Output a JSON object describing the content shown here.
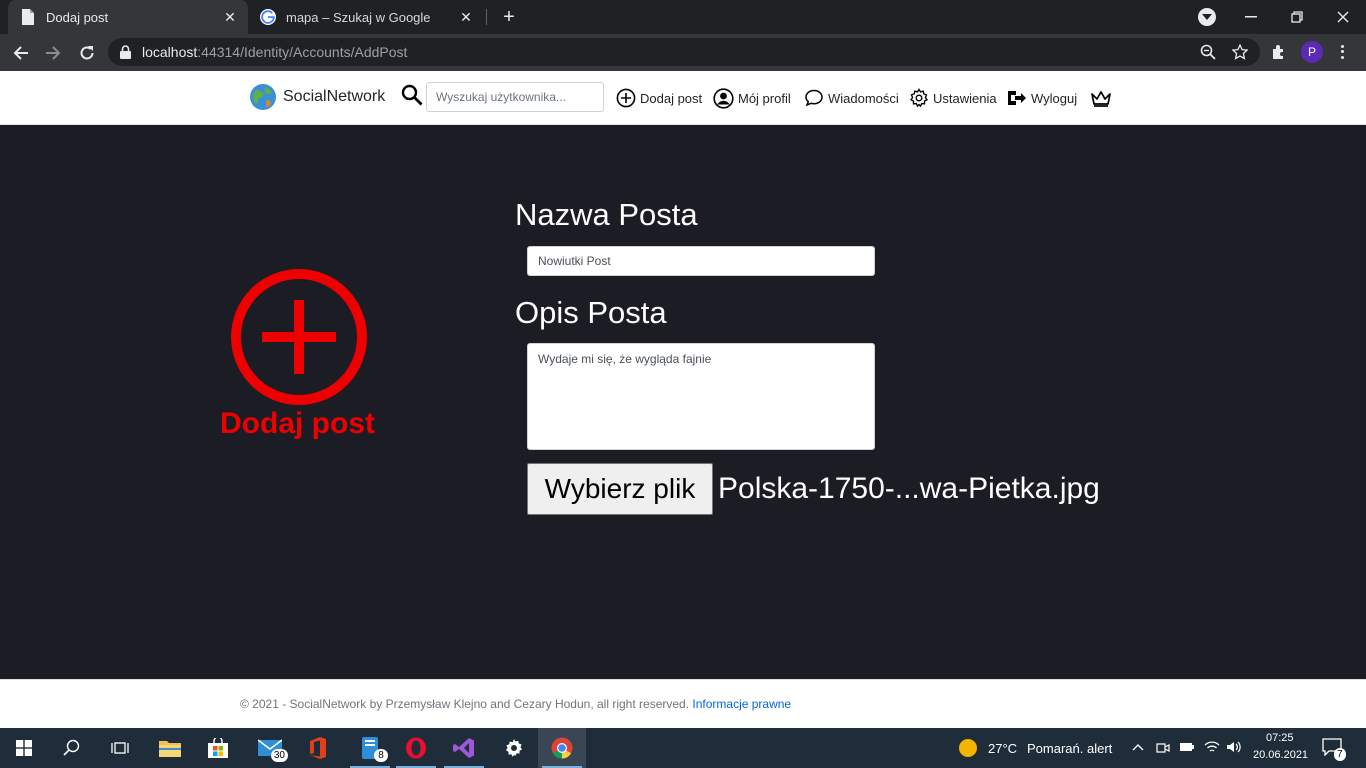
{
  "browser": {
    "tabs": [
      {
        "title": "Dodaj post",
        "close": "✕",
        "active": true
      },
      {
        "title": "mapa – Szukaj w Google",
        "close": "✕",
        "active": false
      }
    ],
    "new_tab": "+",
    "url_host": "localhost",
    "url_rest": ":44314/Identity/Accounts/AddPost",
    "profile_initial": "P",
    "icons": [
      "back-icon",
      "forward-icon",
      "reload-icon",
      "lock-icon",
      "zoom-icon",
      "star-icon",
      "extensions-icon",
      "menu-icon"
    ]
  },
  "navbar": {
    "brand": "SocialNetwork",
    "search_placeholder": "Wyszukaj użytkownika...",
    "links": {
      "add_post": "Dodaj post",
      "profile": "Mój profil",
      "messages": "Wiadomości",
      "settings": "Ustawienia",
      "logout": "Wyloguj"
    }
  },
  "main": {
    "hero_label": "Dodaj post",
    "title_label": "Nazwa Posta",
    "title_value": "Nowiutki Post",
    "desc_label": "Opis Posta",
    "desc_value": "Wydaje mi się, że wygląda fajnie",
    "file_button": "Wybierz plik",
    "file_name": "Polska-1750-...wa-Pietka.jpg",
    "accent_color": "#ee0000"
  },
  "footer": {
    "text": "© 2021 - SocialNetwork by Przemysław Klejno and Cezary Hodun, all right reserved.",
    "link": "Informacje prawne"
  },
  "taskbar": {
    "badges": {
      "mail": "30",
      "files": "8"
    },
    "weather_temp": "27°C",
    "weather_alert": "Pomarań. alert",
    "time": "07:25",
    "date": "20.06.2021",
    "notifications": "7"
  }
}
